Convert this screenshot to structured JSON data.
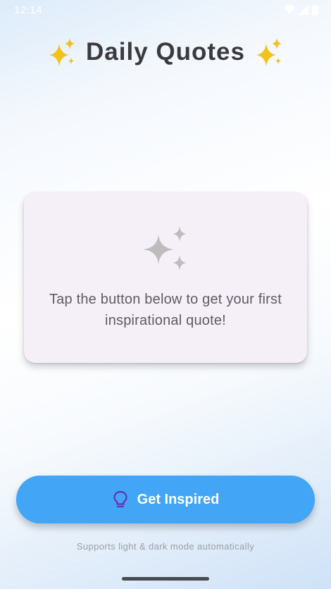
{
  "status_bar": {
    "time": "12:14"
  },
  "header": {
    "title": "Daily Quotes",
    "leading_icon": "sparkles-icon",
    "trailing_icon": "sparkles-icon"
  },
  "card": {
    "icon": "auto-awesome-icon",
    "message": "Tap the button below to get your first inspirational quote!"
  },
  "cta": {
    "label": "Get Inspired",
    "icon": "lightbulb-icon"
  },
  "footer": {
    "note": "Supports light & dark mode automatically"
  },
  "colors": {
    "accent": "#42a5f5",
    "card": "#f5f0f8",
    "title": "#3b3b3f",
    "spark": "#f2c21a"
  }
}
